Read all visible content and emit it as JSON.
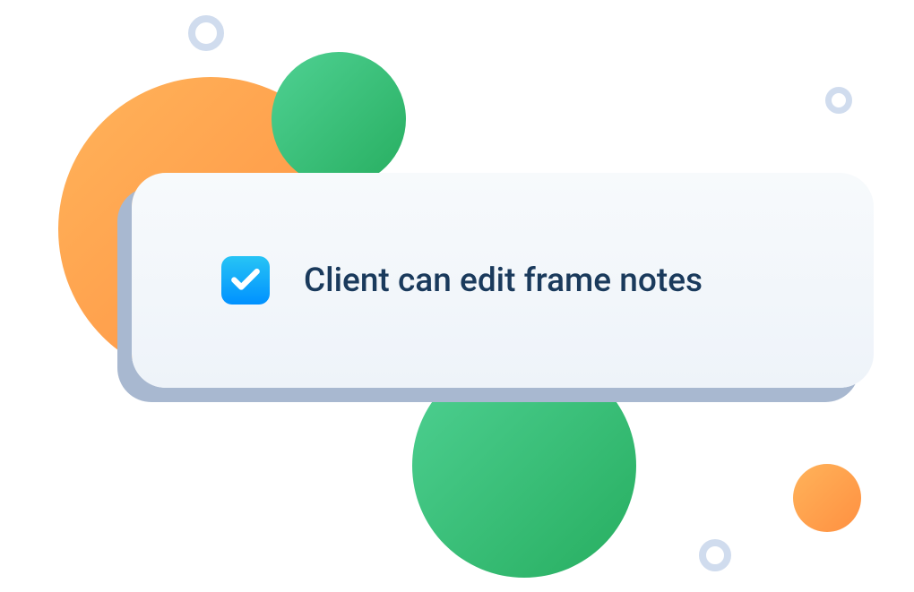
{
  "option": {
    "label": "Client can edit frame notes",
    "checked": true
  },
  "colors": {
    "orange_gradient_start": "#ffb35a",
    "orange_gradient_end": "#ff9041",
    "green_gradient_start": "#4fd193",
    "green_gradient_end": "#27ae60",
    "checkbox_gradient_start": "#27c4f5",
    "checkbox_gradient_end": "#0091ff",
    "text_color": "#1a3a5c",
    "ring_color": "#d0dcee",
    "card_shadow": "#a8b8d0"
  }
}
